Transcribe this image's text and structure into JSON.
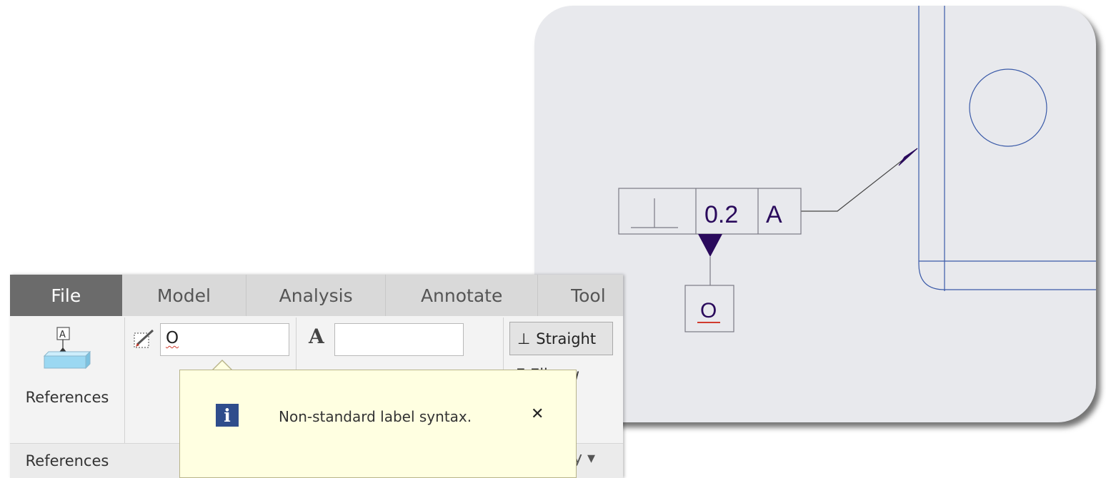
{
  "drawing": {
    "gtol": {
      "characteristic_symbol": "perpendicularity",
      "tolerance": "0.2",
      "datum_ref": "A"
    },
    "datum_label": "O",
    "colors": {
      "panel_bg": "#e8e9ed",
      "geometry_line": "#3a5aa8",
      "frame_line": "#7a7a85",
      "annotation_text": "#2a0a5c",
      "datum_triangle": "#2a0a5c",
      "error_underline": "#d13b2e"
    }
  },
  "ribbon": {
    "tabs": [
      "File",
      "Model",
      "Analysis",
      "Annotate",
      "Tool"
    ],
    "active_tab": "File",
    "references_button_label": "References",
    "references_group_label": "References",
    "label_input_value": "O",
    "text_input_value": "",
    "font_icon": "A",
    "straight_button_label": "Straight",
    "elbow_partial_label": "E  Elb  ow",
    "footer_partial_label": "y ▾"
  },
  "tooltip": {
    "message": "Non-standard label syntax.",
    "icon": "info-icon",
    "close_glyph": "✕"
  }
}
